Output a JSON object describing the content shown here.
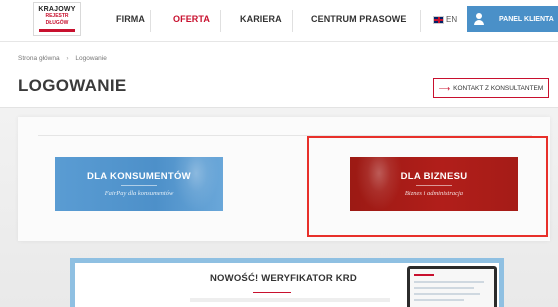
{
  "header": {
    "logo_line1": "KRAJOWY",
    "logo_line2": "REJESTR DŁUGÓW",
    "nav": [
      {
        "label": "FIRMA"
      },
      {
        "label": "OFERTA",
        "active": true
      },
      {
        "label": "KARIERA"
      },
      {
        "label": "CENTRUM PRASOWE"
      }
    ],
    "language": "EN",
    "client_panel_label": "PANEL KLIENTA"
  },
  "breadcrumb": [
    "Strona główna",
    "Logowanie"
  ],
  "page": {
    "title": "LOGOWANIE",
    "contact_button": "KONTAKT Z KONSULTANTEM"
  },
  "cards": {
    "consumers": {
      "title": "DLA KONSUMENTÓW",
      "subtitle": "FairPay dla konsumentów"
    },
    "business": {
      "title": "DLA BIZNESU",
      "subtitle": "Biznes i administracja"
    }
  },
  "banner": {
    "title": "NOWOŚĆ! WERYFIKATOR KRD"
  },
  "colors": {
    "brand_red": "#c8102e",
    "consumer_blue": "#4d90c9",
    "business_red": "#b11e1a",
    "highlight": "#e8302a",
    "client_button": "#4a90c8"
  },
  "icons": [
    "user-icon",
    "uk-flag-icon",
    "arrow-right-icon"
  ]
}
